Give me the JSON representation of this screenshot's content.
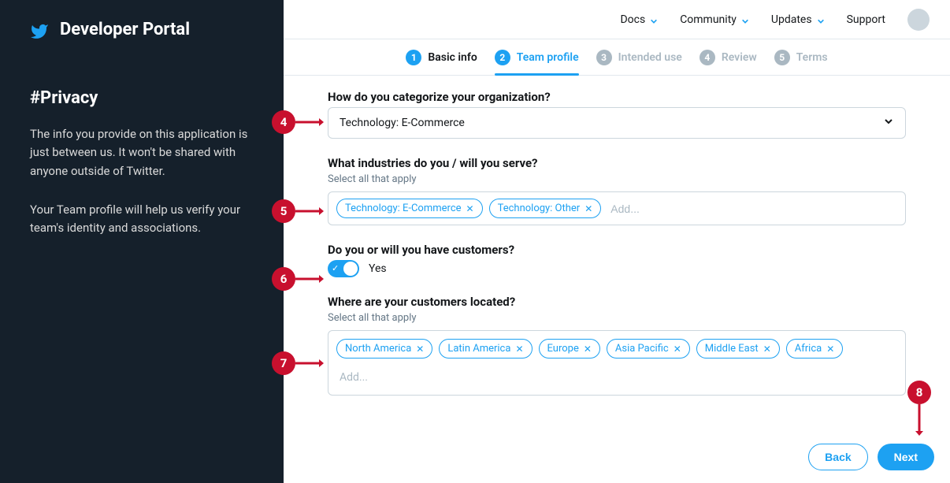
{
  "sidebar": {
    "portal_title": "Developer Portal",
    "heading": "#Privacy",
    "paragraph1": "The info you provide on this application is just between us. It won't be shared with anyone outside of Twitter.",
    "paragraph2": "Your Team profile will help us verify your team's identity and associations."
  },
  "topnav": {
    "items": [
      "Docs",
      "Community",
      "Updates",
      "Support"
    ]
  },
  "stepper": {
    "steps": [
      {
        "num": "1",
        "label": "Basic info"
      },
      {
        "num": "2",
        "label": "Team profile"
      },
      {
        "num": "3",
        "label": "Intended use"
      },
      {
        "num": "4",
        "label": "Review"
      },
      {
        "num": "5",
        "label": "Terms"
      }
    ]
  },
  "fields": {
    "category": {
      "label": "How do you categorize your organization?",
      "value": "Technology: E-Commerce"
    },
    "industries": {
      "label": "What industries do you / will you serve?",
      "hint": "Select all that apply",
      "tags": [
        "Technology: E-Commerce",
        "Technology: Other"
      ],
      "placeholder": "Add..."
    },
    "customers": {
      "label": "Do you or will you have customers?",
      "value": "Yes"
    },
    "locations": {
      "label": "Where are your customers located?",
      "hint": "Select all that apply",
      "tags": [
        "North America",
        "Latin America",
        "Europe",
        "Asia Pacific",
        "Middle East",
        "Africa"
      ],
      "placeholder": "Add..."
    }
  },
  "footer": {
    "back": "Back",
    "next": "Next"
  },
  "markers": {
    "m4": "4",
    "m5": "5",
    "m6": "6",
    "m7": "7",
    "m8": "8"
  }
}
